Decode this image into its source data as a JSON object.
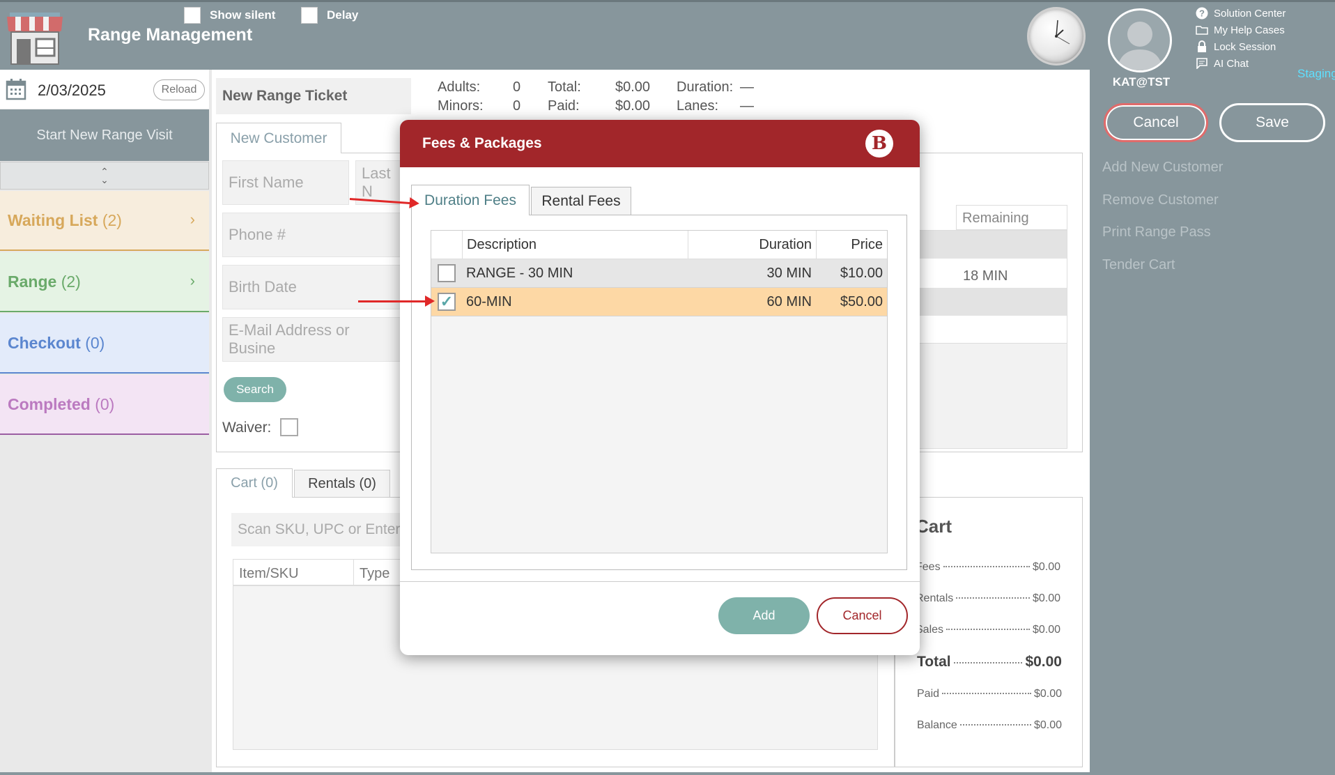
{
  "header": {
    "title": "Range Management",
    "show_silent_label": "Show silent",
    "delay_label": "Delay"
  },
  "user": {
    "name": "KAT@TST",
    "environment": "Staging"
  },
  "util_links": [
    {
      "label": "Solution Center",
      "icon": "help-circle-icon"
    },
    {
      "label": "My Help Cases",
      "icon": "folder-icon"
    },
    {
      "label": "Lock Session",
      "icon": "lock-icon"
    },
    {
      "label": "AI Chat",
      "icon": "chat-icon"
    }
  ],
  "actions": {
    "cancel": "Cancel",
    "save": "Save",
    "side": [
      "Add New Customer",
      "Remove Customer",
      "Print Range Pass",
      "Tender Cart"
    ]
  },
  "left": {
    "date": "2/03/2025",
    "reload": "Reload",
    "start_visit": "Start New Range Visit",
    "queues": [
      {
        "label": "Waiting List",
        "count": "(2)"
      },
      {
        "label": "Range",
        "count": "(2)"
      },
      {
        "label": "Checkout",
        "count": "(0)"
      },
      {
        "label": "Completed",
        "count": "(0)"
      }
    ]
  },
  "ticket": {
    "title": "New Range Ticket",
    "adults_label": "Adults:",
    "adults": "0",
    "minors_label": "Minors:",
    "minors": "0",
    "total_label": "Total:",
    "total": "$0.00",
    "paid_label": "Paid:",
    "paid": "$0.00",
    "duration_label": "Duration:",
    "duration": "—",
    "lanes_label": "Lanes:",
    "lanes": "—"
  },
  "customer": {
    "tab": "New Customer",
    "first_name_ph": "First Name",
    "last_name_ph": "Last N",
    "phone_ph": "Phone #",
    "birth_ph": "Birth Date",
    "email_ph": "E-Mail Address or Busine",
    "search": "Search",
    "waiver": "Waiver:",
    "remaining_head": "Remaining",
    "remaining_value": "18 MIN"
  },
  "cart": {
    "tab_cart": "Cart (0)",
    "tab_rentals": "Rentals (0)",
    "sku_ph": "Scan SKU, UPC or Enter d",
    "col_item": "Item/SKU",
    "col_type": "Type",
    "heading": "Cart",
    "rows": [
      {
        "label": "Fees",
        "value": "$0.00"
      },
      {
        "label": "Rentals",
        "value": "$0.00"
      },
      {
        "label": "Sales",
        "value": "$0.00"
      }
    ],
    "total_label": "Total",
    "total": "$0.00",
    "paid_label": "Paid",
    "paid": "$0.00",
    "balance_label": "Balance",
    "balance": "$0.00"
  },
  "modal": {
    "title": "Fees & Packages",
    "logo_letter": "B",
    "tab_duration": "Duration Fees",
    "tab_rental": "Rental Fees",
    "columns": {
      "description": "Description",
      "duration": "Duration",
      "price": "Price"
    },
    "rows": [
      {
        "description": "RANGE - 30 MIN",
        "duration": "30 MIN",
        "price": "$10.00",
        "checked": false
      },
      {
        "description": "60-MIN",
        "duration": "60 MIN",
        "price": "$50.00",
        "checked": true
      }
    ],
    "add": "Add",
    "cancel": "Cancel"
  },
  "colors": {
    "header_bg": "#87969c",
    "modal_header": "#a2262a",
    "selected_row": "#fdd8a5",
    "accent_teal": "#7fb2aa"
  }
}
